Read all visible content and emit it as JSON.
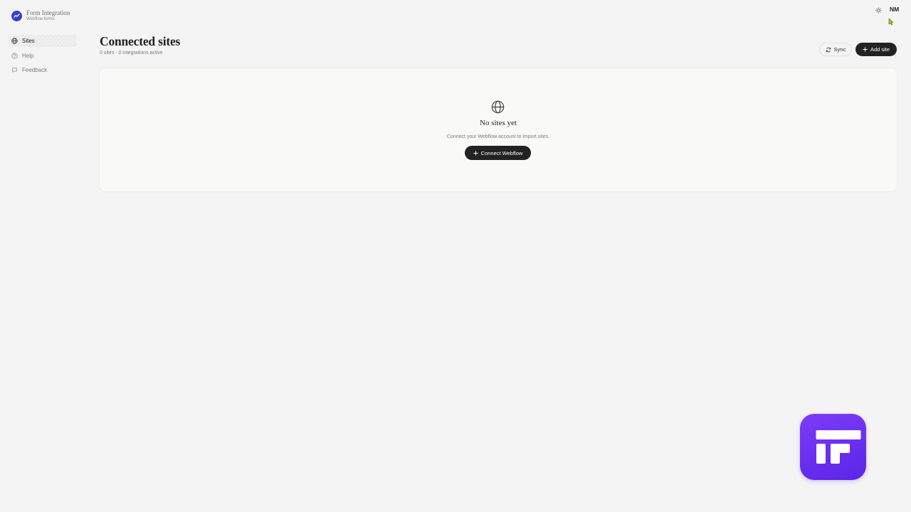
{
  "brand": {
    "name": "Form Integration",
    "subtitle": "Webflow forms",
    "accent": "#3343c8"
  },
  "sidebar": {
    "items": [
      {
        "label": "Sites",
        "icon": "globe-icon",
        "active": true
      },
      {
        "label": "Help",
        "icon": "help-circle-icon",
        "active": false
      },
      {
        "label": "Feedback",
        "icon": "message-icon",
        "active": false
      }
    ]
  },
  "topbar": {
    "theme_icon": "sun-icon",
    "avatar_initials": "NM"
  },
  "header": {
    "title": "Connected sites",
    "subtitle": "0 sites · 0 integrations active",
    "sync_label": "Sync",
    "add_label": "Add site"
  },
  "empty_state": {
    "icon": "globe-icon",
    "title": "No sites yet",
    "description": "Connect your Webflow account to import sites.",
    "button_label": "Connect Webflow"
  },
  "floating_app": {
    "icon": "form-app-icon",
    "color": "#6a2ff0"
  },
  "colors": {
    "background": "#f4f4f4",
    "card": "#f9f9f7",
    "primary_button": "#222222",
    "cursor": "#9bd21c"
  }
}
